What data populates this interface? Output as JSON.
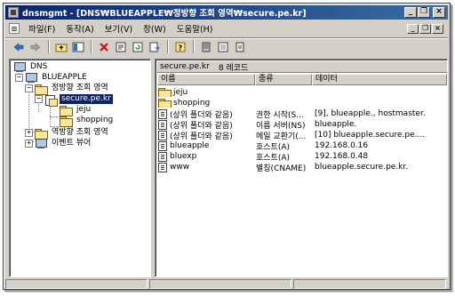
{
  "window": {
    "title": "dnsmgmt - [DNS₩BLUEAPPLE₩정방향 조회 영역₩secure.pe.kr]"
  },
  "menu": {
    "items": [
      "파일(F)",
      "동작(A)",
      "보기(V)",
      "창(W)",
      "도움말(H)"
    ]
  },
  "caption_buttons": {
    "minimize": "_",
    "restore": "❐",
    "close": "×"
  },
  "mdi_buttons": {
    "minimize": "_",
    "restore": "❐",
    "close": "×"
  },
  "toolbar": {
    "buttons": [
      "back-icon",
      "forward-icon",
      "up-folder-icon",
      "show-tree-icon",
      "delete-icon",
      "properties-icon",
      "refresh-icon",
      "export-icon",
      "help-icon",
      "server-icon",
      "zone-list-icon",
      "record-icon"
    ]
  },
  "tree": {
    "root": "DNS",
    "server": "BLUEAPPLE",
    "forward_zone": "정방향 조회 영역",
    "selected_zone": "secure.pe.kr",
    "subdomain_1": "jeju",
    "subdomain_2": "shopping",
    "reverse_zone": "역방향 조회 영역",
    "event_viewer": "이벤트 뷰어"
  },
  "details": {
    "zone_name": "secure.pe.kr",
    "record_count": "8 레코드",
    "columns": [
      "이름",
      "종류",
      "데이터"
    ],
    "rows": [
      {
        "name": "jeju",
        "type": "",
        "data": "",
        "icon": "folder"
      },
      {
        "name": "shopping",
        "type": "",
        "data": "",
        "icon": "folder"
      },
      {
        "name": "(상위 폴더와 같음)",
        "type": "권한 시작(S...",
        "data": "[9], blueapple., hostmaster.",
        "icon": "record"
      },
      {
        "name": "(상위 폴더와 같음)",
        "type": "이름 서버(NS)",
        "data": "blueapple.",
        "icon": "record"
      },
      {
        "name": "(상위 폴더와 같음)",
        "type": "메일 교환기(...",
        "data": "[10]  blueapple.secure.pe....",
        "icon": "record"
      },
      {
        "name": "blueapple",
        "type": "호스트(A)",
        "data": "192.168.0.16",
        "icon": "record"
      },
      {
        "name": "bluexp",
        "type": "호스트(A)",
        "data": "192.168.0.48",
        "icon": "record"
      },
      {
        "name": "www",
        "type": "별칭(CNAME)",
        "data": "blueapple.secure.pe.kr.",
        "icon": "record"
      }
    ]
  },
  "colors": {
    "title_gradient_start": "#0a246a",
    "title_gradient_end": "#3a6ea5",
    "selection": "#0a246a",
    "chrome": "#d4d0c8"
  }
}
